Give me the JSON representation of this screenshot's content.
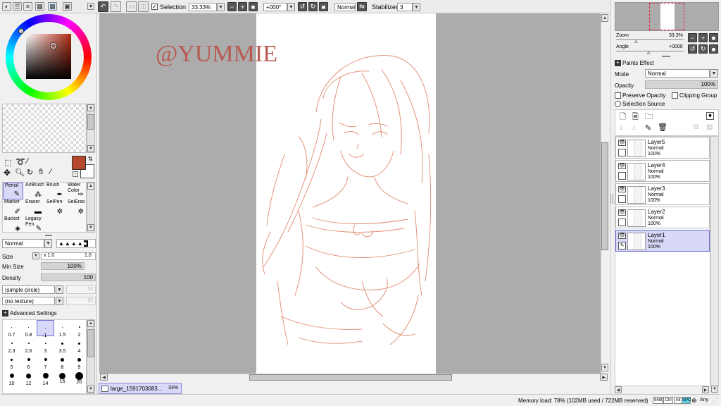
{
  "top_toolbar": {
    "selection_label": "Selection",
    "zoom_value": "33.33%",
    "angle_value": "+000°",
    "blend_mode": "Normal",
    "stabilizer_label": "Stabilizer",
    "stabilizer_value": "3"
  },
  "left_panel": {
    "primary_color": "#b5482c",
    "tools": [
      {
        "name": "Pencil"
      },
      {
        "name": "AirBrush"
      },
      {
        "name": "Brush"
      },
      {
        "name": "Water Color"
      },
      {
        "name": "Marker"
      },
      {
        "name": "Eraser"
      },
      {
        "name": "SelPen"
      },
      {
        "name": "SelEras"
      },
      {
        "name": "Bucket"
      },
      {
        "name": "Legacy Pen"
      }
    ],
    "brush_mode": "Normal",
    "size_label": "Size",
    "size_multiplier": "x 1.0",
    "size_value": "1.0",
    "min_size_label": "Min Size",
    "min_size_value": "100%",
    "density_label": "Density",
    "density_value": "100",
    "shape_select": "(simple circle)",
    "shape_value": "50",
    "texture_select": "(no texture)",
    "texture_value": "95",
    "advanced_settings": "Advanced Settings",
    "brush_sizes": [
      "0.7",
      "0.8",
      "1",
      "1.5",
      "2",
      "2.3",
      "2.6",
      "3",
      "3.5",
      "4",
      "5",
      "6",
      "7",
      "8",
      "9",
      "10",
      "12",
      "14",
      "16",
      "20"
    ]
  },
  "canvas": {
    "watermark": "@YUMMIE",
    "tab_name": "large_1591703083...",
    "tab_zoom": "33%"
  },
  "right_panel": {
    "zoom_label": "Zoom",
    "zoom_value": "33.3%",
    "angle_label": "Angle",
    "angle_value": "+0000",
    "paints_effect": "Paints Effect",
    "mode_label": "Mode",
    "mode_value": "Normal",
    "opacity_label": "Opacity",
    "opacity_value": "100%",
    "preserve_opacity": "Preserve Opacity",
    "clipping_group": "Clipping Group",
    "selection_source": "Selection Source",
    "layers": [
      {
        "name": "Layer5",
        "mode": "Normal",
        "opacity": "100%"
      },
      {
        "name": "Layer4",
        "mode": "Normal",
        "opacity": "100%"
      },
      {
        "name": "Layer3",
        "mode": "Normal",
        "opacity": "100%"
      },
      {
        "name": "Layer2",
        "mode": "Normal",
        "opacity": "100%"
      },
      {
        "name": "Layer1",
        "mode": "Normal",
        "opacity": "100%"
      }
    ]
  },
  "status": {
    "memory": "Memory load: 78% (102MB used / 722MB reserved)",
    "keys": [
      "Shift",
      "Ctrl",
      "Alt",
      "SPC"
    ],
    "any": "Any"
  }
}
